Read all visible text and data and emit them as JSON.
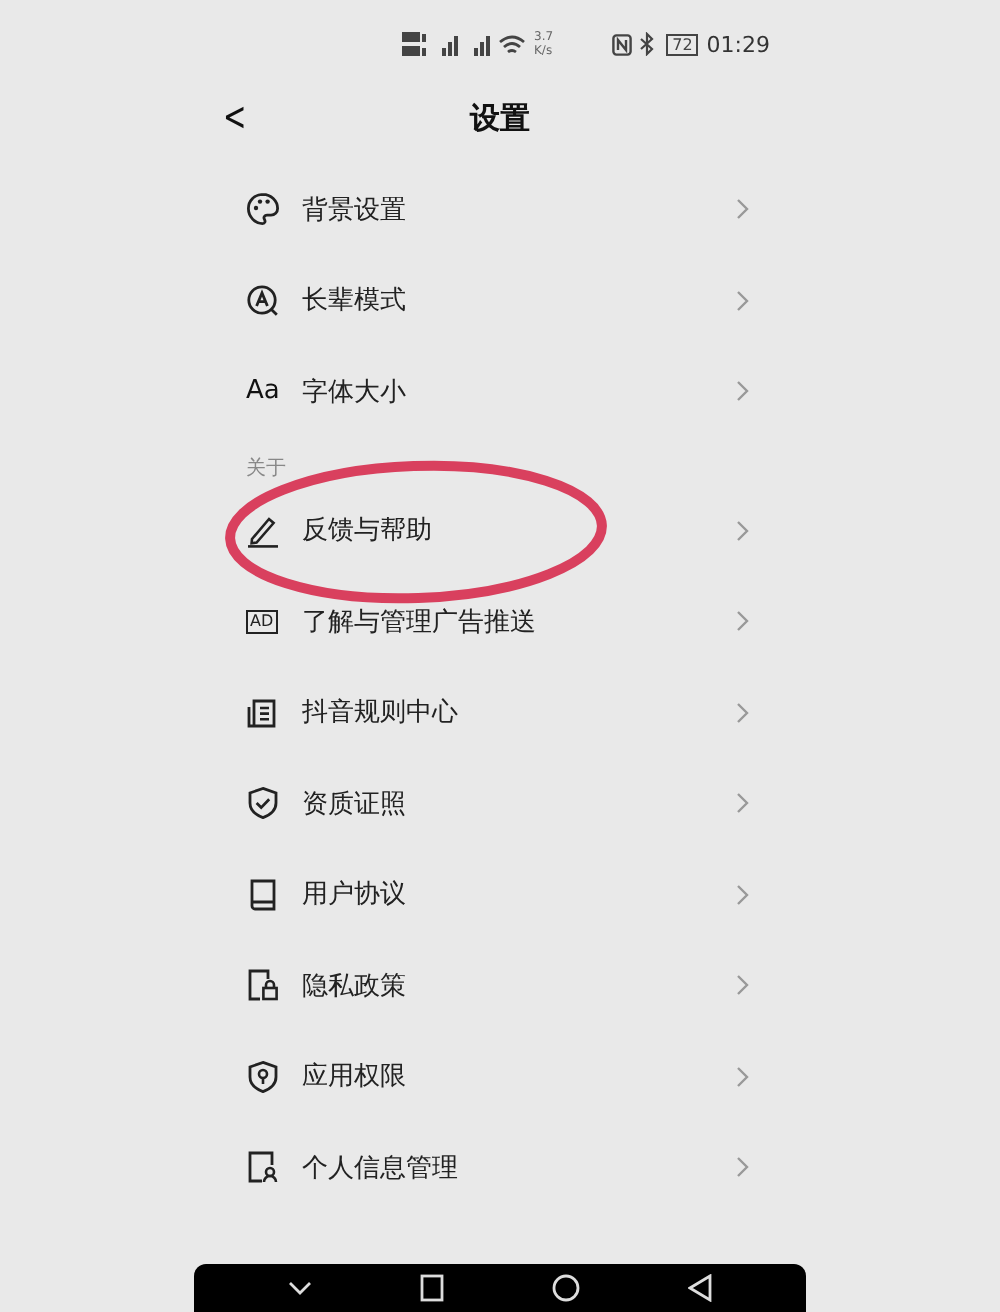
{
  "status_bar": {
    "speed_value": "3.7",
    "speed_unit": "K/s",
    "battery": "72",
    "time": "01:29"
  },
  "header": {
    "back": "<",
    "title": "设置"
  },
  "sections": [
    {
      "items": [
        {
          "label": "背景设置",
          "circled": false
        },
        {
          "label": "长辈模式",
          "circled": false
        },
        {
          "icon_text": "Aa",
          "label": "字体大小",
          "circled": false
        }
      ]
    },
    {
      "heading": "关于",
      "items": [
        {
          "label": "反馈与帮助",
          "circled": true
        },
        {
          "icon_text": "AD",
          "label": "了解与管理广告推送",
          "circled": false
        },
        {
          "label": "抖音规则中心",
          "circled": false
        },
        {
          "label": "资质证照",
          "circled": false
        },
        {
          "label": "用户协议",
          "circled": false
        },
        {
          "label": "隐私政策",
          "circled": false
        },
        {
          "label": "应用权限",
          "circled": false
        },
        {
          "label": "个人信息管理",
          "circled": false
        }
      ]
    }
  ]
}
